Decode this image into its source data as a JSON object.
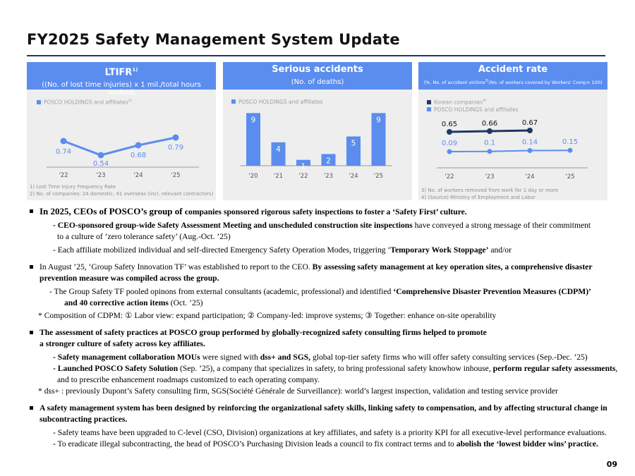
{
  "title": "FY2025 Safety Management System Update",
  "page_number": "09",
  "colors": {
    "header": "#5b8def",
    "rule": "#1f3864",
    "posco_series": "#5b8def",
    "korean_series": "#1f3864"
  },
  "panels": {
    "ltifr": {
      "title": "LTIFR",
      "title_sup": "1)",
      "subtitle": "((No. of lost time injuries) x 1 mil./total hours worked)",
      "legend": "POSCO HOLDINGS and affiliates",
      "legend_sup": "2)",
      "footnotes": [
        "1) Lost Time Injury Frequency Rate",
        "2) No. of companies: 24 domestic, 41 overseas (incl. relevant contractors)"
      ]
    },
    "serious": {
      "title": "Serious accidents",
      "subtitle": "(No. of deaths)",
      "legend": "POSCO HOLDINGS and affiliates"
    },
    "accident_rate": {
      "title": "Accident rate",
      "subtitle": "(%, No. of accident victims",
      "subtitle_sup": "3)",
      "subtitle_rest": "/No. of workers covered by Workers' Comp× 100)",
      "legend_korean": "Korean companies",
      "legend_korean_sup": "4)",
      "legend_posco": "POSCO HOLDINGS and affiliates",
      "footnotes": [
        "3) No. of workers removed from work for 1 day or more",
        "4) (Source) Ministry of Employment and Labor"
      ]
    }
  },
  "chart_data": [
    {
      "type": "line",
      "categories": [
        "'22",
        "'23",
        "'24",
        "'25"
      ],
      "series": [
        {
          "name": "POSCO HOLDINGS and affiliates",
          "values": [
            0.74,
            0.54,
            0.68,
            0.79
          ]
        }
      ]
    },
    {
      "type": "bar",
      "categories": [
        "'20",
        "'21",
        "'22",
        "'23",
        "'24",
        "'25"
      ],
      "series": [
        {
          "name": "POSCO HOLDINGS and affiliates",
          "values": [
            9,
            4,
            1,
            2,
            5,
            9
          ]
        }
      ]
    },
    {
      "type": "line",
      "categories": [
        "'22",
        "'23",
        "'24",
        "'25"
      ],
      "series": [
        {
          "name": "Korean companies",
          "values": [
            0.65,
            0.66,
            0.67,
            null
          ]
        },
        {
          "name": "POSCO HOLDINGS and affiliates",
          "values": [
            0.09,
            0.1,
            0.14,
            0.15
          ]
        }
      ]
    }
  ],
  "body": {
    "b1": {
      "main_a": "In 2025, CEOs of POSCO’s group of ",
      "main_b": "companies sponsored rigorous safety inspections to foster a ‘Safety First’ culture.",
      "s1_bold": "- CEO-sponsored group-wide Safety Assessment Meeting and unscheduled construction site inspections",
      "s1_rest": " have conveyed a strong message of their commitment",
      "s1_line2": "to a culture of ‘zero tolerance safety’ (Aug.-Oct. ’25)",
      "s2_a": "- Each affiliate mobilized individual and self-directed Emergency Safety Operation Modes, triggering ‘",
      "s2_bold": "Temporary Work Stoppage’",
      "s2_c": " and/or"
    },
    "b2": {
      "main_a": "In August ’25, ‘Group Safety Innovation TF’ was established to report to the CEO. ",
      "main_b": "By assessing safety management at key operation sites, a comprehensive disaster",
      "main_line2": "prevention measure was compiled across the group.",
      "s1_a": "- The Group Safety TF pooled opinons from external consultants (academic, professional) and identified ",
      "s1_bold": "‘Comprehensive Disaster Prevention Measures (CDPM)’",
      "s1_line2_bold": "and 40 corrective action items",
      "s1_line2_rest": " (Oct. ’25)",
      "note": "* Composition of CDPM: ① Labor view: expand participation; ② Company-led: improve systems; ③ Together: enhance on-site operability"
    },
    "b3": {
      "main": "The assessment of safety practices at POSCO group performed by globally-recognized safety consulting firms helped to promote",
      "main_line2": "a stronger culture of safety across key affiliates.",
      "s1_bold": "- Safety management collaboration MOUs",
      "s1_b": " were signed with ",
      "s1_bold2": "dss+ and SGS,",
      "s1_c": " global top-tier safety firms who will offer safety consulting services (Sep.-Dec. ’25)",
      "s2_bold": "- Launched POSCO Safety Solution",
      "s2_b": " (Sep. ’25), a company that specializes in safety, to bring professional safety knowhow inhouse, ",
      "s2_bold2": "perform regular safety assessments",
      "s2_c": ",",
      "s2_line2": "and to prescribe enhancement roadmaps customized to each operating company.",
      "note": "* dss+ : previously Dupont’s Safety consulting firm, SGS(Société Générale de Surveillance): world’s largest inspection, validation and testing service provider"
    },
    "b4": {
      "main": "A safety management system has been designed by reinforcing the organizational safety skills, linking safety to compensation, and by affecting structural change in",
      "main_line2": "subcontracting practices.",
      "s1": "- Safety teams have been upgraded to C-level (CSO, Division) organizations at key affiliates, and safety is a priority KPI for all executive-level performance evaluations.",
      "s2_a": "- To eradicate illegal subcontracting, the head of POSCO’s Purchasing Division leads a council to fix contract terms and to ",
      "s2_bold": "abolish the ‘lowest bidder wins’ practice."
    }
  }
}
